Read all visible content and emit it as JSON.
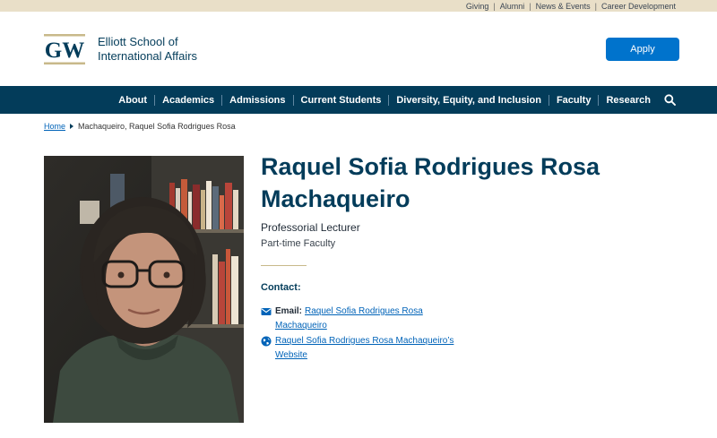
{
  "utility_nav": {
    "links": [
      "Giving",
      "Alumni",
      "News & Events",
      "Career Development"
    ]
  },
  "header": {
    "logo_text": "GW",
    "site_name_line1": "Elliott School of",
    "site_name_line2": "International Affairs",
    "apply_label": "Apply"
  },
  "main_nav": {
    "items": [
      "About",
      "Academics",
      "Admissions",
      "Current Students",
      "Diversity, Equity, and Inclusion",
      "Faculty",
      "Research"
    ],
    "search_icon": "search-icon"
  },
  "breadcrumb": {
    "home": "Home",
    "current": "Machaqueiro, Raquel Sofia Rodrigues Rosa"
  },
  "profile": {
    "name_line1": "Raquel Sofia Rodrigues Rosa",
    "name_line2": "Machaqueiro",
    "title": "Professorial Lecturer",
    "role": "Part-time Faculty",
    "contact_heading": "Contact:",
    "email_label": "Email:",
    "email_link_line1": "Raquel Sofia Rodrigues Rosa",
    "email_link_line2": "Machaqueiro",
    "website_link_line1": "Raquel Sofia Rodrigues Rosa Machaqueiro’s",
    "website_link_line2": "Website"
  },
  "colors": {
    "brand_navy": "#033c5a",
    "utility_bar": "#e9dfc8",
    "apply_blue": "#0073cc",
    "link_blue": "#0063b8",
    "gold": "#c8b98a"
  }
}
